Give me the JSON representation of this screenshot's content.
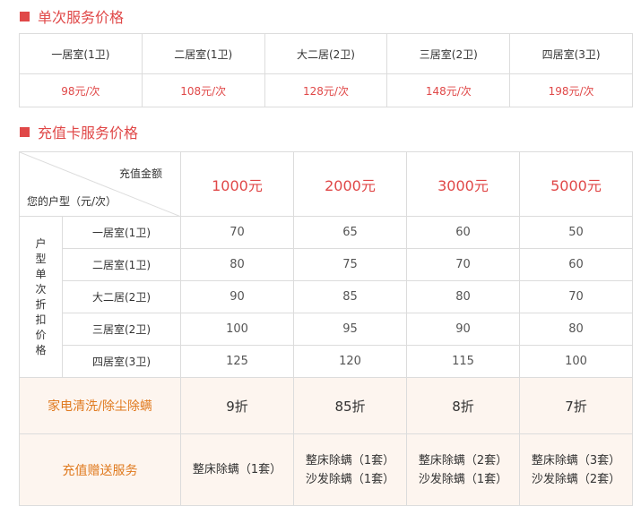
{
  "single": {
    "title": "单次服务价格",
    "rooms": [
      "一居室(1卫)",
      "二居室(1卫)",
      "大二居(2卫)",
      "三居室(2卫)",
      "四居室(3卫)"
    ],
    "prices": [
      "98元/次",
      "108元/次",
      "128元/次",
      "148元/次",
      "198元/次"
    ]
  },
  "card": {
    "title": "充值卡服务价格",
    "corner_top": "充值金额",
    "corner_bottom": "您的户型（元/次）",
    "amounts": [
      "1000元",
      "2000元",
      "3000元",
      "5000元"
    ],
    "side_label": "户型单次折扣价格",
    "rows": [
      {
        "name": "一居室(1卫)",
        "values": [
          "70",
          "65",
          "60",
          "50"
        ]
      },
      {
        "name": "二居室(1卫)",
        "values": [
          "80",
          "75",
          "70",
          "60"
        ]
      },
      {
        "name": "大二居(2卫)",
        "values": [
          "90",
          "85",
          "80",
          "70"
        ]
      },
      {
        "name": "三居室(2卫)",
        "values": [
          "100",
          "95",
          "90",
          "80"
        ]
      },
      {
        "name": "四居室(3卫)",
        "values": [
          "125",
          "120",
          "115",
          "100"
        ]
      }
    ],
    "discount_label": "家电清洗/除尘除螨",
    "discounts": [
      "9折",
      "85折",
      "8折",
      "7折"
    ],
    "gift_label": "充值赠送服务",
    "gifts": [
      [
        "整床除螨（1套）"
      ],
      [
        "整床除螨（1套）",
        "沙发除螨（1套）"
      ],
      [
        "整床除螨（2套）",
        "沙发除螨（1套）"
      ],
      [
        "整床除螨（3套）",
        "沙发除螨（2套）"
      ]
    ]
  },
  "colors": {
    "accent": "#e04848",
    "orange": "#e07a1f",
    "highlight_bg": "#fdf5ef"
  }
}
